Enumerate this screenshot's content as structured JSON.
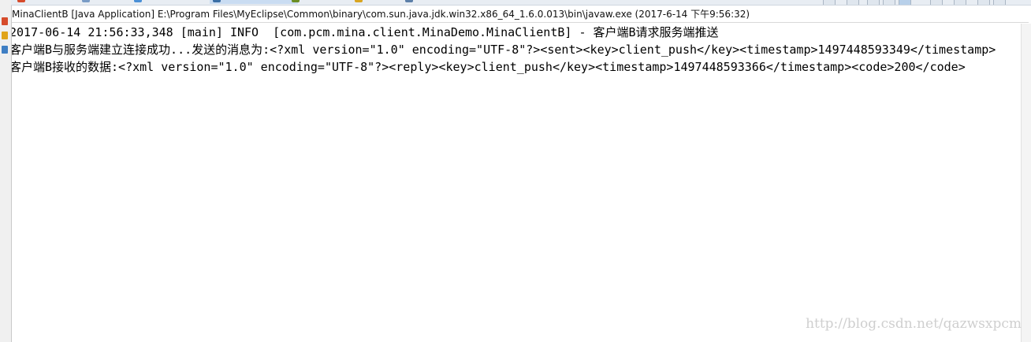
{
  "console": {
    "title": "MinaClientB [Java Application] E:\\Program Files\\MyEclipse\\Common\\binary\\com.sun.java.jdk.win32.x86_64_1.6.0.013\\bin\\javaw.exe (2017-6-14 下午9:56:32)",
    "lines": [
      "2017-06-14 21:56:33,348 [main] INFO  [com.pcm.mina.client.MinaDemo.MinaClientB] - 客户端B请求服务端推送",
      "客户端B与服务端建立连接成功...发送的消息为:<?xml version=\"1.0\" encoding=\"UTF-8\"?><sent><key>client_push</key><timestamp>1497448593349</timestamp>",
      "客户端B接收的数据:<?xml version=\"1.0\" encoding=\"UTF-8\"?><reply><key>client_push</key><timestamp>1497448593366</timestamp><code>200</code>"
    ]
  },
  "watermark": "http://blog.csdn.net/qazwsxpcm",
  "colors": {
    "background": "#ffffff",
    "text": "#000000",
    "watermark": "#cfcfcf"
  }
}
